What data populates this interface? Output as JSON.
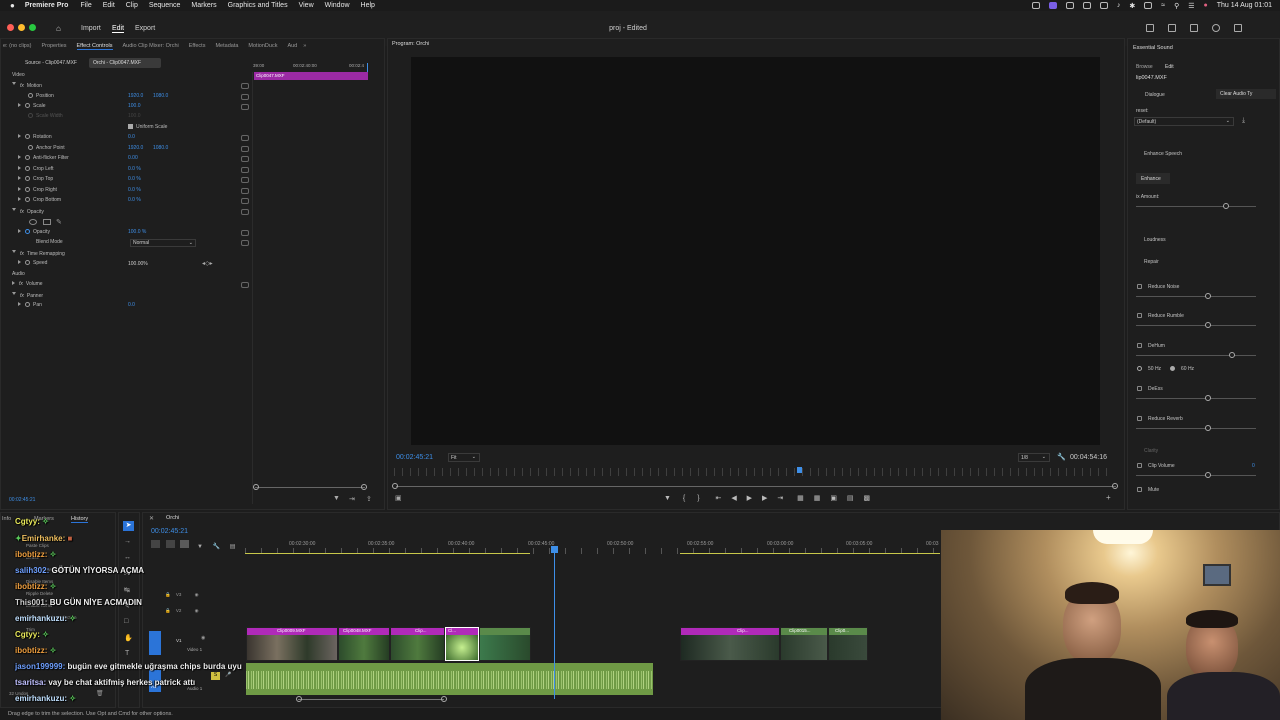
{
  "menubar": {
    "app": "Premiere Pro",
    "items": [
      "File",
      "Edit",
      "Clip",
      "Sequence",
      "Markers",
      "Graphics and Titles",
      "View",
      "Window",
      "Help"
    ],
    "datetime": "Thu 14 Aug  01:01"
  },
  "header": {
    "tabs": [
      "Import",
      "Edit",
      "Export"
    ],
    "title": "proj - Edited"
  },
  "effect_controls": {
    "tabs": [
      "e: (no clips)",
      "Properties",
      "Effect Controls",
      "Audio Clip Mixer: Orchi",
      "Effects",
      "Metadata",
      "MotionDuck",
      "Aud"
    ],
    "source_label": "Source - Clip0047.MXF",
    "sequence_label": "Orchi - Clip0047.MXF",
    "ruler_times": [
      "39:00",
      "00:02:40:00",
      "00:02:4"
    ],
    "mini_clip": "Clip0047.MXF",
    "rows": {
      "video": "Video",
      "motion": "Motion",
      "position": "Position",
      "position_x": "1920.0",
      "position_y": "1080.0",
      "scale": "Scale",
      "scale_val": "100.0",
      "scale_width": "Scale Width",
      "scale_width_val": "100.0",
      "uniform_scale": "Uniform Scale",
      "rotation": "Rotation",
      "rotation_val": "0.0",
      "anchor_point": "Anchor Point",
      "anchor_x": "1920.0",
      "anchor_y": "1080.0",
      "anti_flicker": "Anti-flicker Filter",
      "anti_flicker_val": "0.00",
      "crop_left": "Crop Left",
      "crop_left_val": "0.0 %",
      "crop_top": "Crop Top",
      "crop_top_val": "0.0 %",
      "crop_right": "Crop Right",
      "crop_right_val": "0.0 %",
      "crop_bottom": "Crop Bottom",
      "crop_bottom_val": "0.0 %",
      "opacity": "Opacity",
      "opacity_sub": "Opacity",
      "opacity_val": "100.0 %",
      "blend_mode": "Blend Mode",
      "blend_val": "Normal",
      "time_remapping": "Time Remapping",
      "speed": "Speed",
      "speed_val": "100.00%",
      "audio": "Audio",
      "volume": "Volume",
      "panner": "Panner",
      "pan": "Pan",
      "pan_val": "0.0"
    },
    "footer_time": "00:02:45:21"
  },
  "program": {
    "tab": "Program: Orchi",
    "timecode": "00:02:45:21",
    "fit": "Fit",
    "resolution": "1/8",
    "duration": "00:04:54:16"
  },
  "essential_sound": {
    "tab": "Essential Sound",
    "subtabs": [
      "Browse",
      "Edit"
    ],
    "clip": "lip0047.MXF",
    "dialogue": "Dialogue",
    "clear_button": "Clear Audio Ty",
    "preset_label": "reset:",
    "preset_value": "(Default)",
    "enhance_speech": "Enhance Speech",
    "enhance_button": "Enhance",
    "mix_amount": "ix Amount:",
    "loudness": "Loudness",
    "repair": "Repair",
    "reduce_noise": "Reduce Noise",
    "reduce_rumble": "Reduce Rumble",
    "dehum": "DeHum",
    "hz50": "50 Hz",
    "hz60": "60 Hz",
    "deess": "DeEss",
    "reduce_reverb": "Reduce Reverb",
    "clarity": "Clarity",
    "clip_volume": "Clip Volume",
    "clip_volume_val": "0",
    "mute": "Mute"
  },
  "history": {
    "tabs": [
      "Info",
      "Markers",
      "History"
    ],
    "items": [
      "Paste Clips",
      "Delete",
      "Lift & Overwrite Selection",
      "Disable Items",
      "Ripple Delete",
      "Enable Items",
      "Lift & Overwrite Selection",
      "Trim"
    ],
    "undos": "32 Undos"
  },
  "timeline": {
    "tab": "Orchi",
    "timecode": "00:02:45:21",
    "ruler": [
      "00:02:30:00",
      "00:02:35:00",
      "00:02:40:00",
      "00:02:45:00",
      "00:02:50:00",
      "00:02:55:00",
      "00:03:00:00",
      "00:03:05:00",
      "00:03"
    ],
    "tracks": [
      "V3",
      "V2",
      "V1",
      "A1",
      "A2",
      "A3"
    ],
    "video_track_name": "Video 1",
    "audio_track_name": "Audio 1",
    "clips": [
      "Clip0009.MXF",
      "Clip0048.MXF",
      "Clip...",
      "Cl...",
      "Clip...",
      "Clip0015...",
      "Clip0..."
    ]
  },
  "chat": [
    {
      "user": "Cgtyy:",
      "msg": "",
      "color": "#e8e85a"
    },
    {
      "user": "Emirhanke:",
      "msg": "",
      "color": "#f0c060"
    },
    {
      "user": "ibobtizz:",
      "msg": "",
      "color": "#f0a040"
    },
    {
      "user": "salih302:",
      "msg": "GÖTÜN YİYORSA AÇMA",
      "color": "#6fa0ff"
    },
    {
      "user": "ibobtizz:",
      "msg": "",
      "color": "#f0a040"
    },
    {
      "user": "This001:",
      "msg": "BU GÜN NİYE ACMADIN",
      "color": "#d0d0d0"
    },
    {
      "user": "emirhankuzu:",
      "msg": "",
      "color": "#c0e0ff"
    },
    {
      "user": "Cgtyy:",
      "msg": "",
      "color": "#e8e85a"
    },
    {
      "user": "ibobtizz:",
      "msg": "",
      "color": "#f0a040"
    },
    {
      "user": "jason199999:",
      "msg": "bugün eve gitmekle uğraşma chips burda uyu",
      "color": "#6fa0ff"
    },
    {
      "user": "tsaritsa:",
      "msg": "vay be chat aktifmiş herkes patrick attı",
      "color": "#c0c0ff"
    },
    {
      "user": "emirhankuzu:",
      "msg": "",
      "color": "#c0e0ff"
    }
  ],
  "status_bar": "Drag edge to trim the selection. Use Opt and Cmd for other options.",
  "colors": {
    "accent_blue": "#2b74d8",
    "clip_pink": "#b02ab9",
    "audio_green": "#7fa050"
  }
}
